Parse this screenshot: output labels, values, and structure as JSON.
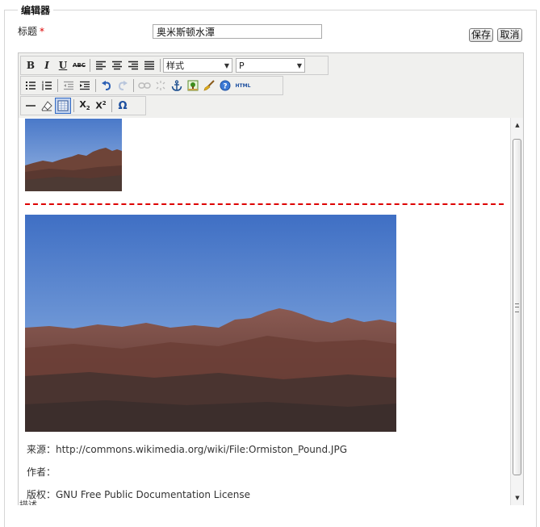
{
  "form": {
    "legend": "编辑器",
    "title_label": "标题",
    "required_mark": "*",
    "title_value": "奥米斯顿水潭",
    "save_label": "保存",
    "cancel_label": "取消",
    "next_label_partial": "描述"
  },
  "toolbar": {
    "bold": "B",
    "italic": "I",
    "underline": "U",
    "strike": "ABC",
    "style_select": "样式",
    "format_select": "P",
    "html": "HTML",
    "subscript": "X",
    "superscript": "X",
    "special_char": "Ω"
  },
  "content": {
    "source": "来源：http://commons.wikimedia.org/wiki/File:Ormiston_Pound.JPG",
    "author": "作者：",
    "license": "版权：GNU Free Public Documentation License"
  }
}
